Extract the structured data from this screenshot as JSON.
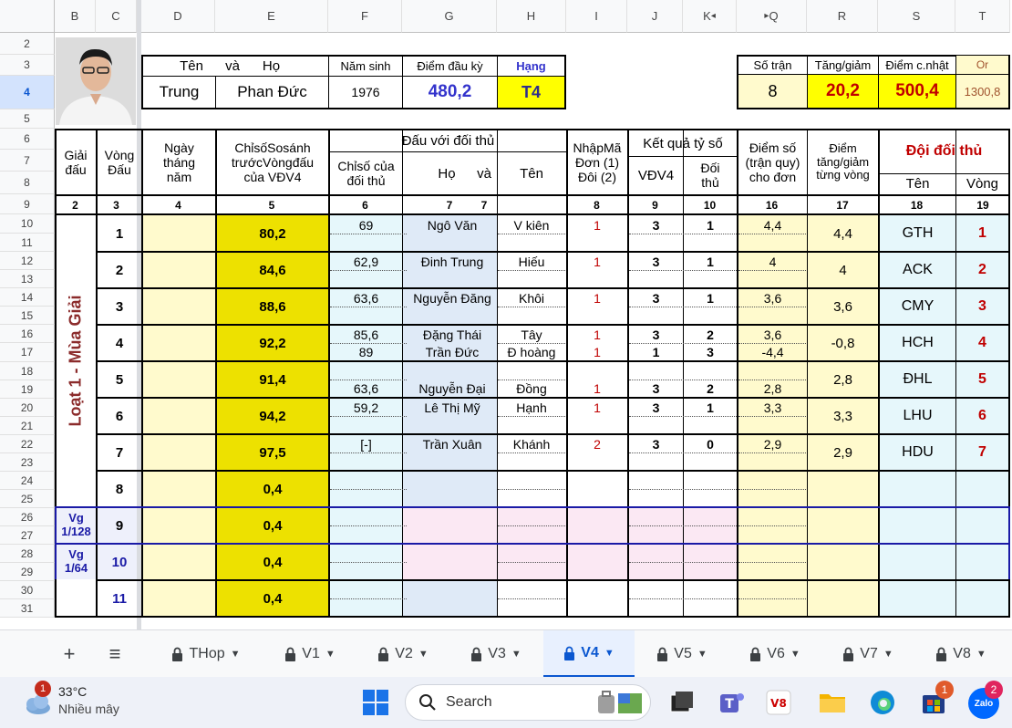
{
  "columns": [
    "B",
    "C",
    "D",
    "E",
    "F",
    "G",
    "H",
    "I",
    "J",
    "K",
    "Q",
    "R",
    "S",
    "T"
  ],
  "rows": [
    "2",
    "3",
    "4",
    "5",
    "6",
    "7",
    "8",
    "9",
    "10",
    "11",
    "12",
    "13",
    "14",
    "15",
    "16",
    "17",
    "18",
    "19",
    "20",
    "21",
    "22",
    "23",
    "24",
    "25",
    "26",
    "27",
    "28",
    "29",
    "30",
    "31"
  ],
  "header": {
    "ten_va_ho": [
      "Tên",
      "và",
      "Họ"
    ],
    "nam_sinh_label": "Năm sinh",
    "diem_dau_ky_label": "Điểm đầu kỳ",
    "hang_label": "Hạng",
    "first_name": "Trung",
    "last_name": "Phan Đức",
    "nam_sinh": "1976",
    "diem_dau_ky": "480,2",
    "hang": "T4",
    "so_tran_label": "Số trận",
    "tang_giam_label": "Tăng/giảm",
    "diem_cnhat_label": "Điểm c.nhật",
    "or_label": "Or",
    "so_tran": "8",
    "tang_giam": "20,2",
    "diem_cnhat": "500,4",
    "or_value": "1300,8"
  },
  "table_head": {
    "giai_dau": [
      "Giải",
      "đấu"
    ],
    "vong_dau": [
      "Vòng",
      "Đấu"
    ],
    "ngay": [
      "Ngày",
      "tháng",
      "năm"
    ],
    "chiso": [
      "ChỉsốSosánh",
      "trướcVòngđấu",
      "của VĐV4"
    ],
    "dau_voi": "Đấu với đối thủ",
    "chiso_doi": [
      "Chỉsố của",
      "đối thủ"
    ],
    "ho": "Họ",
    "va": "và",
    "ten": "Tên",
    "nhapma": [
      "NhậpMã",
      "Đơn (1)",
      "Đôi (2)"
    ],
    "ketqua": "Kết quả tỷ số",
    "vdv4": "VĐV4",
    "doithu": [
      "Đối",
      "thủ"
    ],
    "diemso": [
      "Điểm số",
      "(trận quy)",
      "cho đơn"
    ],
    "diem_tang": [
      "Điểm",
      "tăng/giảm",
      "từng vòng"
    ],
    "doi_doi_thu": "Đội đối thủ",
    "ten2": "Tên",
    "vong": "Vòng"
  },
  "col_numbers": [
    "2",
    "3",
    "4",
    "5",
    "6",
    "7",
    "",
    "8",
    "9",
    "10",
    "16",
    "17",
    "18",
    "19"
  ],
  "season_label": "Loạt 1 - Mùa Giải",
  "vg1": [
    "Vg",
    "1/128"
  ],
  "vg2": [
    "Vg",
    "1/64"
  ],
  "rounds": [
    {
      "vong": "1",
      "chiso": "80,2",
      "diem_tang": "4,4",
      "doi": "GTH",
      "vong_doi": "1",
      "matches": [
        {
          "cs": "69",
          "ho": "Ngô Văn",
          "ten": "V kiên",
          "ma": "1",
          "a": "3",
          "b": "1",
          "d": "4,4"
        }
      ]
    },
    {
      "vong": "2",
      "chiso": "84,6",
      "diem_tang": "4",
      "doi": "ACK",
      "vong_doi": "2",
      "matches": [
        {
          "cs": "62,9",
          "ho": "Đinh Trung",
          "ten": "Hiếu",
          "ma": "1",
          "a": "3",
          "b": "1",
          "d": "4"
        }
      ]
    },
    {
      "vong": "3",
      "chiso": "88,6",
      "diem_tang": "3,6",
      "doi": "CMY",
      "vong_doi": "3",
      "matches": [
        {
          "cs": "63,6",
          "ho": "Nguyễn Đăng",
          "ten": "Khôi",
          "ma": "1",
          "a": "3",
          "b": "1",
          "d": "3,6"
        }
      ]
    },
    {
      "vong": "4",
      "chiso": "92,2",
      "diem_tang": "-0,8",
      "doi": "HCH",
      "vong_doi": "4",
      "matches": [
        {
          "cs": "85,6",
          "ho": "Đặng Thái",
          "ten": "Tây",
          "ma": "1",
          "a": "3",
          "b": "2",
          "d": "3,6"
        },
        {
          "cs": "89",
          "ho": "Trần Đức",
          "ten": "Đ hoàng",
          "ma": "1",
          "a": "1",
          "b": "3",
          "d": "-4,4"
        }
      ]
    },
    {
      "vong": "5",
      "chiso": "91,4",
      "diem_tang": "2,8",
      "doi": "ĐHL",
      "vong_doi": "5",
      "matches": [
        {
          "cs": "63,6",
          "ho": "Nguyễn Đại",
          "ten": "Đồng",
          "ma": "1",
          "a": "3",
          "b": "2",
          "d": "2,8"
        }
      ]
    },
    {
      "vong": "6",
      "chiso": "94,2",
      "diem_tang": "3,3",
      "doi": "LHU",
      "vong_doi": "6",
      "matches": [
        {
          "cs": "59,2",
          "ho": "Lê Thị Mỹ",
          "ten": "Hạnh",
          "ma": "1",
          "a": "3",
          "b": "1",
          "d": "3,3"
        }
      ]
    },
    {
      "vong": "7",
      "chiso": "97,5",
      "diem_tang": "2,9",
      "doi": "HDU",
      "vong_doi": "7",
      "matches": [
        {
          "cs": "[-]",
          "ho": "Trần Xuân",
          "ten": "Khánh",
          "ma": "2",
          "a": "3",
          "b": "0",
          "d": "2,9"
        }
      ]
    },
    {
      "vong": "8",
      "chiso": "0,4",
      "diem_tang": "",
      "doi": "",
      "vong_doi": "",
      "matches": []
    },
    {
      "vong": "9",
      "chiso": "0,4",
      "diem_tang": "",
      "doi": "",
      "vong_doi": "",
      "matches": []
    },
    {
      "vong": "10",
      "chiso": "0,4",
      "diem_tang": "",
      "doi": "",
      "vong_doi": "",
      "matches": []
    },
    {
      "vong": "11",
      "chiso": "0,4",
      "diem_tang": "",
      "doi": "",
      "vong_doi": "",
      "matches": []
    }
  ],
  "tabs": {
    "add": "+",
    "menu": "≡",
    "sheets": [
      "THop",
      "V1",
      "V2",
      "V3",
      "V4",
      "V5",
      "V6",
      "V7",
      "V8"
    ],
    "active": "V4"
  },
  "taskbar": {
    "weather_badge": "1",
    "temp": "33°C",
    "weather_text": "Nhiều mây",
    "search_placeholder": "Search",
    "store_badge": "1",
    "zalo_badge": "2",
    "zalo_label": "Zalo"
  }
}
